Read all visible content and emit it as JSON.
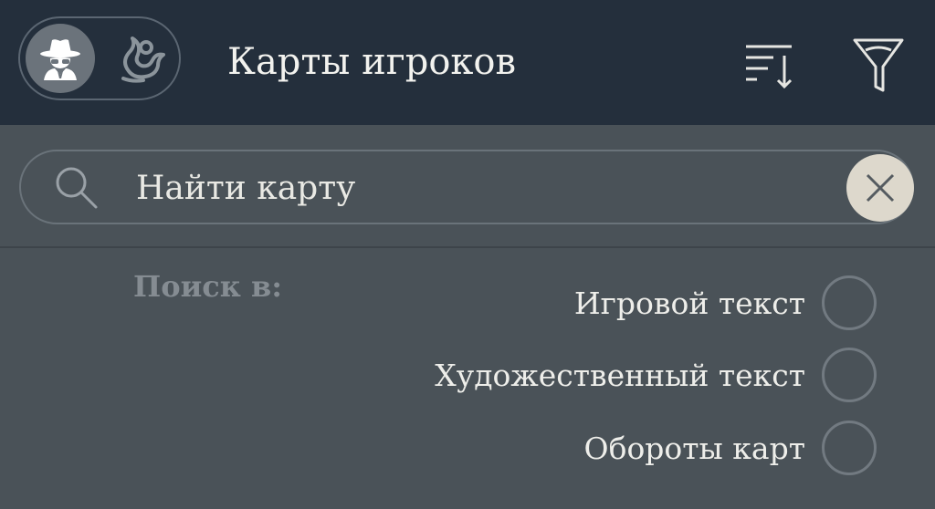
{
  "header": {
    "title": "Карты игроков",
    "mode_toggle": {
      "options": [
        {
          "icon": "investigator-icon",
          "selected": true
        },
        {
          "icon": "mythos-tentacle-icon",
          "selected": false
        }
      ]
    },
    "actions": [
      {
        "icon": "sort-icon"
      },
      {
        "icon": "filter-icon"
      }
    ]
  },
  "search": {
    "placeholder": "Найти карту",
    "value": "",
    "icon": "search-icon",
    "clear_icon": "close-icon"
  },
  "search_in": {
    "label": "Поиск в:",
    "options": [
      {
        "label": "Игровой текст",
        "checked": false
      },
      {
        "label": "Художественный текст",
        "checked": false
      },
      {
        "label": "Обороты карт",
        "checked": false
      }
    ]
  },
  "colors": {
    "header_bg": "#242f3c",
    "body_bg": "#4a5258",
    "clear_button_bg": "#ddd8cc",
    "text_primary": "#eeeeea",
    "text_muted": "#858c92"
  }
}
